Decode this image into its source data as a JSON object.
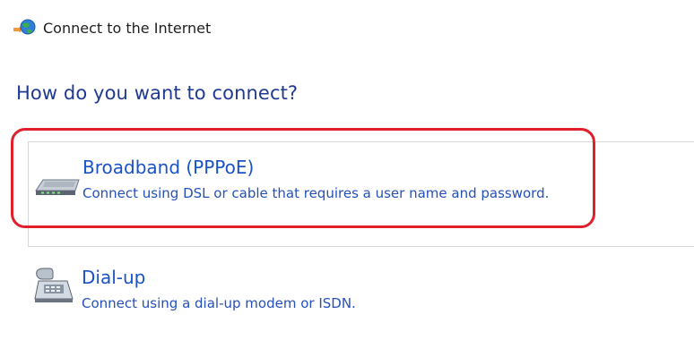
{
  "window": {
    "title": "Connect to the Internet",
    "icon": "globe-network-icon"
  },
  "main": {
    "question": "How do you want to connect?",
    "options": [
      {
        "title": "Broadband (PPPoE)",
        "description": "Connect using DSL or cable that requires a user name and password.",
        "icon": "modem-icon",
        "selected": true
      },
      {
        "title": "Dial-up",
        "description": "Connect using a dial-up modem or ISDN.",
        "icon": "telephone-icon",
        "selected": false
      }
    ]
  },
  "colors": {
    "heading": "#1f3a93",
    "link": "#1a52c8",
    "highlight": "#e0202a"
  }
}
